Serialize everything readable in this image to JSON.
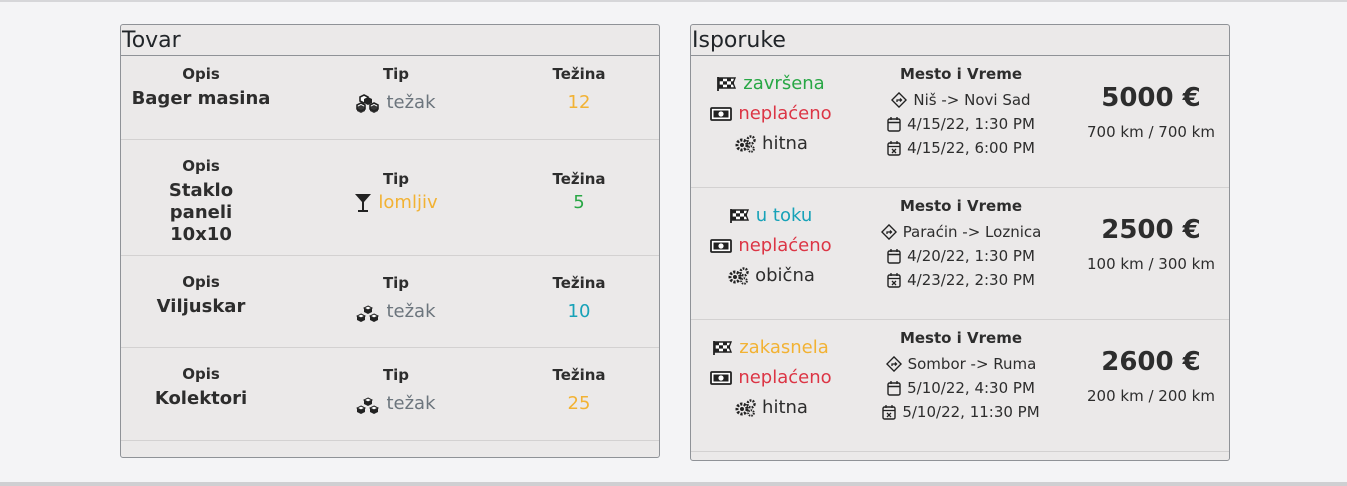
{
  "cargo": {
    "title": "Tovar",
    "headers": {
      "opis": "Opis",
      "tip": "Tip",
      "tezina": "Težina"
    },
    "rows": [
      {
        "opis": "Bager masina",
        "tip": "težak",
        "tip_icon": "boxes-icon",
        "tezina": "12",
        "tezina_color": "#f2b233"
      },
      {
        "opis": "Staklo paneli 10x10",
        "tip": "lomljiv",
        "tip_icon": "glass-icon",
        "tezina": "5",
        "tezina_color": "#28a745"
      },
      {
        "opis": "Viljuskar",
        "tip": "težak",
        "tip_icon": "boxes-icon",
        "tezina": "10",
        "tezina_color": "#17a2b8"
      },
      {
        "opis": "Kolektori",
        "tip": "težak",
        "tip_icon": "boxes-icon",
        "tezina": "25",
        "tezina_color": "#f2b233"
      }
    ]
  },
  "deliveries": {
    "title": "Isporuke",
    "header": "Mesto i Vreme",
    "rows": [
      {
        "status": "završena",
        "status_color": "#28a745",
        "payment": "neplaćeno",
        "priority": "hitna",
        "route": "Niš -> Novi Sad",
        "start": "4/15/22, 1:30 PM",
        "end": "4/15/22, 6:00 PM",
        "price": "5000 €",
        "distance": "700 km / 700 km"
      },
      {
        "status": "u toku",
        "status_color": "#17a2b8",
        "payment": "neplaćeno",
        "priority": "obična",
        "route": "Paraćin -> Loznica",
        "start": "4/20/22, 1:30 PM",
        "end": "4/23/22, 2:30 PM",
        "price": "2500 €",
        "distance": "100 km / 300 km"
      },
      {
        "status": "zakasnela",
        "status_color": "#f2b233",
        "payment": "neplaćeno",
        "priority": "hitna",
        "route": "Sombor -> Ruma",
        "start": "5/10/22, 4:30 PM",
        "end": "5/10/22, 11:30 PM",
        "price": "2600 €",
        "distance": "200 km / 200 km"
      }
    ]
  },
  "colors": {
    "payment": "#dc3545"
  }
}
